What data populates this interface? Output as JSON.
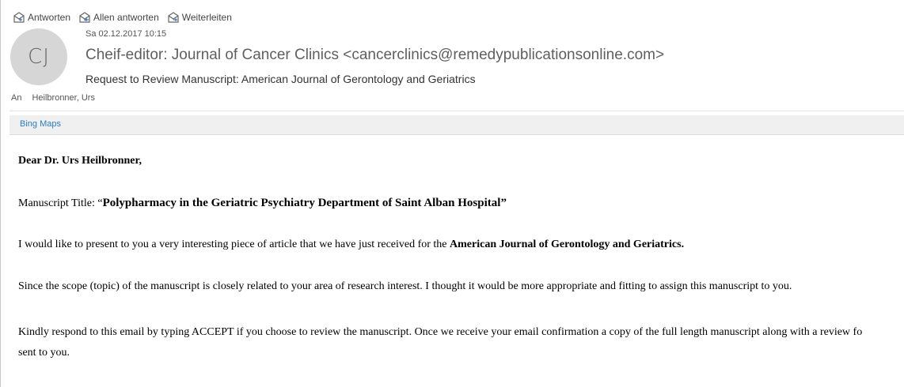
{
  "toolbar": {
    "reply": {
      "label": "Antworten",
      "icon": "reply-icon"
    },
    "reply_all": {
      "label": "Allen antworten",
      "icon": "reply-all-icon"
    },
    "forward": {
      "label": "Weiterleiten",
      "icon": "forward-icon"
    }
  },
  "header": {
    "avatar_initials": "CJ",
    "date": "Sa 02.12.2017 10:15",
    "sender": "Cheif-editor: Journal of Cancer Clinics <cancerclinics@remedypublicationsonline.com>",
    "subject": "Request to Review Manuscript: American Journal of Gerontology and Geriatrics",
    "to_label": "An",
    "to_value": "Heilbronner, Urs"
  },
  "addin_bar": {
    "link": "Bing Maps"
  },
  "body": {
    "greeting": "Dear Dr. Urs Heilbronner,",
    "title_prefix": "Manuscript Title: “",
    "title_text": "Polypharmacy in the Geriatric Psychiatry Department of Saint Alban Hospital”",
    "present_text": "I would like to present to you a very interesting piece of article that we have just received for the ",
    "present_journal": "American Journal of Gerontology and Geriatrics.",
    "scope_text": "Since the scope (topic) of the manuscript is closely related to your area of research interest. I thought it would be more appropriate and fitting to assign this manuscript to you.",
    "kindly_line1": "Kindly respond to this email by typing ACCEPT if you choose to review the manuscript. Once we receive your email confirmation a copy of the full length manuscript along with a review fo",
    "kindly_line2": "sent to you."
  },
  "colors": {
    "link": "#2b7cc1",
    "avatar_bg": "#d6d6d6",
    "addin_bg": "#f0f0f0"
  }
}
